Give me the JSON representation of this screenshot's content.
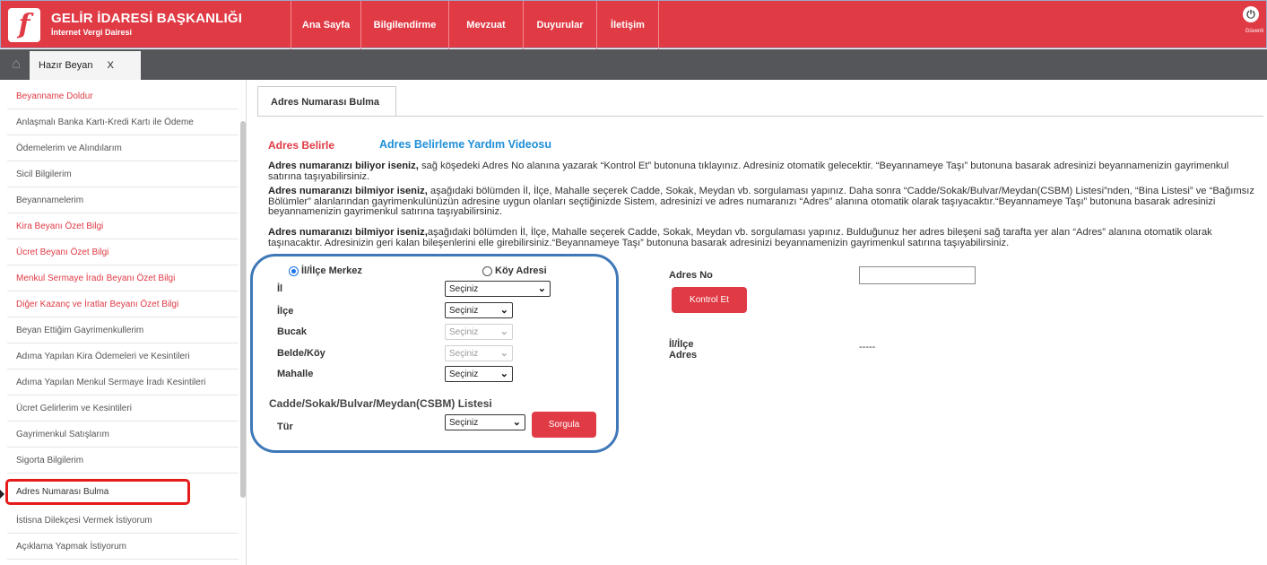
{
  "header": {
    "logo_letter": "f",
    "title": "GELİR İDARESİ BAŞKANLIĞI",
    "subtitle": "İnternet Vergi Dairesi",
    "nav": [
      "Ana Sayfa",
      "Bilgilendirme",
      "Mevzuat",
      "Duyurular",
      "İletişim"
    ],
    "power_icon": "power-icon",
    "power_label": "Güvenli"
  },
  "tabs": {
    "home_icon": "home-icon",
    "open_tab": "Hazır Beyan",
    "close_label": "X"
  },
  "sidebar": {
    "items": [
      {
        "label": "Beyanname Doldur",
        "color": "#e03a45"
      },
      {
        "label": "Anlaşmalı Banka Kartı-Kredi Kartı ile Ödeme",
        "color": "#555555"
      },
      {
        "label": "Ödemelerim ve Alındılarım",
        "color": "#555555"
      },
      {
        "label": "Sicil Bilgilerim",
        "color": "#555555"
      },
      {
        "label": "Beyannamelerim",
        "color": "#555555"
      },
      {
        "label": "Kira Beyanı Özet Bilgi",
        "color": "#e03a45"
      },
      {
        "label": "Ücret Beyanı Özet Bilgi",
        "color": "#e03a45"
      },
      {
        "label": "Menkul Sermaye İradı Beyanı Özet Bilgi",
        "color": "#e03a45"
      },
      {
        "label": "Diğer Kazanç ve İratlar Beyanı Özet Bilgi",
        "color": "#e03a45"
      },
      {
        "label": "Beyan Ettiğim Gayrimenkullerim",
        "color": "#555555"
      },
      {
        "label": "Adıma Yapılan Kira Ödemeleri ve Kesintileri",
        "color": "#555555"
      },
      {
        "label": "Adıma Yapılan Menkul Sermaye İradı Kesintileri",
        "color": "#555555"
      },
      {
        "label": "Ücret Gelirlerim ve Kesintileri",
        "color": "#555555"
      },
      {
        "label": "Gayrimenkul Satışlarım",
        "color": "#555555"
      },
      {
        "label": "Sigorta Bilgilerim",
        "color": "#555555"
      },
      {
        "label": "Adres Numarası Bulma",
        "color": "#333333"
      },
      {
        "label": "İstisna Dilekçesi Vermek İstiyorum",
        "color": "#555555"
      },
      {
        "label": "Açıklama Yapmak İstiyorum",
        "color": "#555555"
      }
    ],
    "highlighted_index": 15
  },
  "content": {
    "tab_label": "Adres Numarası Bulma",
    "adres_belirle": "Adres Belirle",
    "video_link": "Adres Belirleme Yardım Videosu",
    "p1_bold": "Adres numaranızı biliyor iseniz,",
    "p1_text": " sağ köşedeki Adres No alanına yazarak “Kontrol Et” butonuna tıklayınız. Adresiniz otomatik gelecektir. “Beyannameye Taşı” butonuna basarak adresinizi beyannamenizin gayrimenkul satırına taşıyabilirsiniz.",
    "p2_bold": "Adres numaranızı bilmiyor iseniz,",
    "p2_text": " aşağıdaki bölümden İl, İlçe, Mahalle seçerek Cadde, Sokak, Meydan vb. sorgulaması yapınız. Daha sonra “Cadde/Sokak/Bulvar/Meydan(CSBM) Listesi”nden, “Bina Listesi” ve “Bağımsız Bölümler” alanlarından gayrimenkulünüzün adresine uygun olanları seçtiğinizde Sistem, adresinizi ve adres numaranızı “Adres” alanına otomatik olarak taşıyacaktır.“Beyannameye Taşı” butonuna basarak adresinizi beyannamenizin gayrimenkul satırına taşıyabilirsiniz.",
    "p3_bold": "Adres numaranızı bilmiyor iseniz,",
    "p3_text": "aşağıdaki bölümden İl, İlçe, Mahalle seçerek Cadde, Sokak, Meydan vb. sorgulaması yapınız. Bulduğunuz her adres bileşeni sağ tarafta yer alan “Adres” alanına otomatik olarak taşınacaktır. Adresinizin geri kalan bileşenlerini elle girebilirsiniz.“Beyannameye Taşı” butonuna basarak adresinizi beyannamenizin gayrimenkul satırına taşıyabilirsiniz."
  },
  "form": {
    "radio_merkez": "İl/İlçe Merkez",
    "radio_koy": "Köy Adresi",
    "selected_radio": "İl/İlçe Merkez",
    "il_label": "İl",
    "ilce_label": "İlçe",
    "bucak_label": "Bucak",
    "belde_label": "Belde/Köy",
    "mahalle_label": "Mahalle",
    "select_placeholder": "Seçiniz",
    "csbm_title": "Cadde/Sokak/Bulvar/Meydan(CSBM) Listesi",
    "tur_label": "Tür",
    "sorgula": "Sorgula"
  },
  "right": {
    "adres_no_label": "Adres No",
    "kontrol_et": "Kontrol Et",
    "il_ilce_label": "İl/İlçe",
    "adres_label": "Adres",
    "il_ilce_value": "-----"
  },
  "colors": {
    "brand_red": "#e03a45",
    "link_blue": "#1e8fd8",
    "panel_blue": "#3e78b8",
    "highlight_red": "#e51b1b"
  }
}
